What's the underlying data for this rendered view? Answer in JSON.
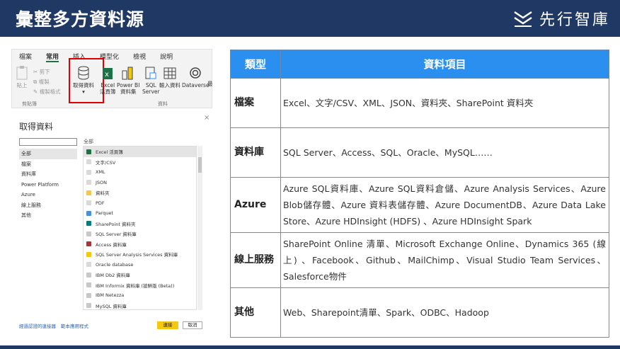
{
  "slide": {
    "title": "彙整多方資料源",
    "logo": {
      "text": "先行智庫",
      "mark": "logo-icon"
    },
    "colors": {
      "bar": "#1f3864",
      "header": "#2b8ff0",
      "highlight": "#e00000",
      "connect": "#f2c811"
    }
  },
  "ribbon": {
    "tabs": [
      "檔案",
      "常用",
      "插入",
      "模型化",
      "檢視",
      "說明"
    ],
    "active_tab": "常用",
    "paste": "貼上",
    "cut": "剪下",
    "copy": "複製",
    "format_painter": "複製格式",
    "clipboard_group": "剪貼簿",
    "get_data_line1": "取得資料",
    "get_data_line2": "▾",
    "excel_line1": "Excel",
    "excel_line2": "活頁簿",
    "powerbi_line1": "Power BI",
    "powerbi_line2": "資料集",
    "sql_line1": "SQL",
    "sql_line2": "Server",
    "enter_data": "輸入資料",
    "dataverse": "Dataverse",
    "more": "最",
    "data_group": "資料"
  },
  "dialog": {
    "title": "取得資料",
    "search_value": "",
    "close": "×",
    "categories": [
      "全部",
      "檔案",
      "資料庫",
      "Power Platform",
      "Azure",
      "線上服務",
      "其他"
    ],
    "selected_category": "全部",
    "sources_header": "全部",
    "sources": [
      {
        "name": "Excel 活頁簿",
        "color": "#1e7145"
      },
      {
        "name": "文字/CSV",
        "color": "#d9d9d9"
      },
      {
        "name": "XML",
        "color": "#d9d9d9"
      },
      {
        "name": "JSON",
        "color": "#d9d9d9"
      },
      {
        "name": "資料夾",
        "color": "#f2c94c"
      },
      {
        "name": "PDF",
        "color": "#d9d9d9"
      },
      {
        "name": "Parquet",
        "color": "#4a90d9"
      },
      {
        "name": "SharePoint 資料夾",
        "color": "#0b7a75"
      },
      {
        "name": "SQL Server 資料庫",
        "color": "#c8c8c8"
      },
      {
        "name": "Access 資料庫",
        "color": "#a4373a"
      },
      {
        "name": "SQL Server Analysis Services 資料庫",
        "color": "#f2c811"
      },
      {
        "name": "Oracle database",
        "color": "#d9d9d9"
      },
      {
        "name": "IBM Db2 資料庫",
        "color": "#c8c8c8"
      },
      {
        "name": "IBM Informix 資料庫 (搶鮮版 (Beta))",
        "color": "#c8c8c8"
      },
      {
        "name": "IBM Netezza",
        "color": "#c8c8c8"
      },
      {
        "name": "MySQL 資料庫",
        "color": "#c8c8c8"
      }
    ],
    "link_certified": "經過認證的連接器",
    "link_template": "範本應用程式",
    "connect": "連接",
    "cancel": "取消"
  },
  "table": {
    "headers": [
      "類型",
      "資料項目"
    ],
    "rows": [
      {
        "type": "檔案",
        "items": "Excel、文字/CSV、XML、JSON、資料夾、SharePoint 資料夾"
      },
      {
        "type": "資料庫",
        "items": "SQL Server、Access、SQL、Oracle、MySQL……"
      },
      {
        "type": "Azure",
        "items": "Azure SQL資料庫、Azure SQL資料倉儲、Azure Analysis Services、Azure Blob儲存體、Azure 資料表儲存體、Azure DocumentDB、Azure Data Lake Store、Azure HDInsight (HDFS) 、Azure HDInsight Spark"
      },
      {
        "type": "線上服務",
        "items": "SharePoint Online 清單、Microsoft Exchange Online、Dynamics 365 (線上) 、Facebook、Github、MailChimp、Visual Studio Team Services、Salesforce物件"
      },
      {
        "type": "其他",
        "items": "Web、Sharepoint清單、Spark、ODBC、Hadoop"
      }
    ]
  }
}
